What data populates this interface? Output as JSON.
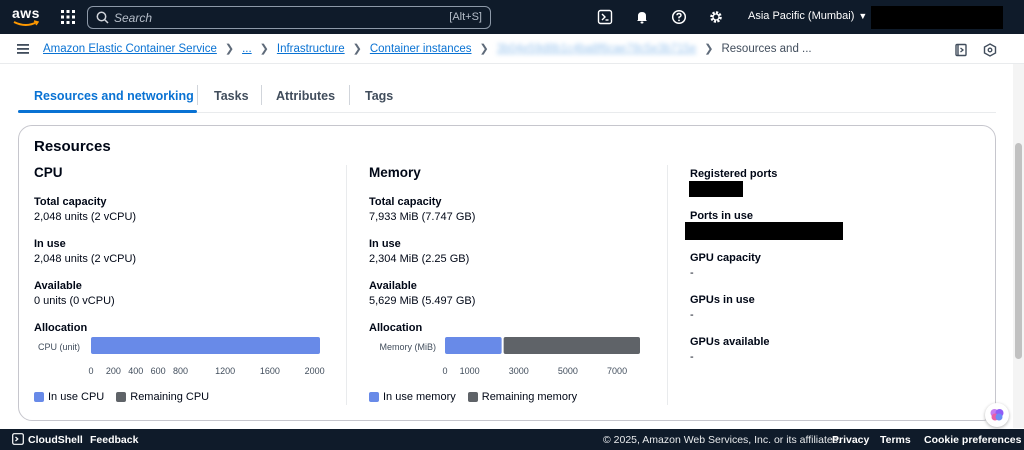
{
  "topnav": {
    "logo_text": "aws",
    "search_placeholder": "Search",
    "search_shortcut": "[Alt+S]",
    "region": "Asia Pacific (Mumbai)"
  },
  "breadcrumb": {
    "items": [
      "Amazon Elastic Container Service",
      "...",
      "Infrastructure",
      "Container instances"
    ],
    "redacted_id": "3b04e59d8b1c4ba8f6cae78c5e3b715e",
    "current": "Resources and ..."
  },
  "tabs": [
    {
      "label": "Resources and networking",
      "active": true
    },
    {
      "label": "Tasks",
      "active": false
    },
    {
      "label": "Attributes",
      "active": false
    },
    {
      "label": "Tags",
      "active": false
    }
  ],
  "resources": {
    "title": "Resources",
    "cpu": {
      "title": "CPU",
      "total_label": "Total capacity",
      "total_value": "2,048 units (2 vCPU)",
      "inuse_label": "In use",
      "inuse_value": "2,048 units (2 vCPU)",
      "available_label": "Available",
      "available_value": "0 units (0 vCPU)",
      "allocation_label": "Allocation",
      "legend_inuse": "In use CPU",
      "legend_remaining": "Remaining CPU"
    },
    "memory": {
      "title": "Memory",
      "total_label": "Total capacity",
      "total_value": "7,933 MiB (7.747 GB)",
      "inuse_label": "In use",
      "inuse_value": "2,304 MiB (2.25 GB)",
      "available_label": "Available",
      "available_value": "5,629 MiB (5.497 GB)",
      "allocation_label": "Allocation",
      "legend_inuse": "In use memory",
      "legend_remaining": "Remaining memory"
    },
    "ports": {
      "registered_label": "Registered ports",
      "inuse_label": "Ports in use",
      "gpu_capacity_label": "GPU capacity",
      "gpu_capacity_value": "-",
      "gpus_inuse_label": "GPUs in use",
      "gpus_inuse_value": "-",
      "gpus_available_label": "GPUs available",
      "gpus_available_value": "-"
    }
  },
  "colors": {
    "inuse": "#688ae8",
    "remaining": "#5f6368",
    "accent": "#0972d3"
  },
  "chart_data": [
    {
      "type": "bar",
      "orientation": "horizontal",
      "stacked": true,
      "categories": [
        "CPU (unit)"
      ],
      "series": [
        {
          "name": "In use CPU",
          "values": [
            2048
          ]
        },
        {
          "name": "Remaining CPU",
          "values": [
            0
          ]
        }
      ],
      "xlim": [
        0,
        2048
      ],
      "xticks": [
        0,
        200,
        400,
        600,
        800,
        1200,
        1600,
        2000
      ],
      "legend": "bottom-left"
    },
    {
      "type": "bar",
      "orientation": "horizontal",
      "stacked": true,
      "categories": [
        "Memory (MiB)"
      ],
      "series": [
        {
          "name": "In use memory",
          "values": [
            2304
          ]
        },
        {
          "name": "Remaining memory",
          "values": [
            5629
          ]
        }
      ],
      "xlim": [
        0,
        7933
      ],
      "xticks": [
        0,
        1000,
        3000,
        5000,
        7000
      ],
      "legend": "bottom-left"
    }
  ],
  "footer": {
    "cloudshell": "CloudShell",
    "feedback": "Feedback",
    "copyright": "© 2025, Amazon Web Services, Inc. or its affiliates.",
    "privacy": "Privacy",
    "terms": "Terms",
    "cookies": "Cookie preferences"
  }
}
